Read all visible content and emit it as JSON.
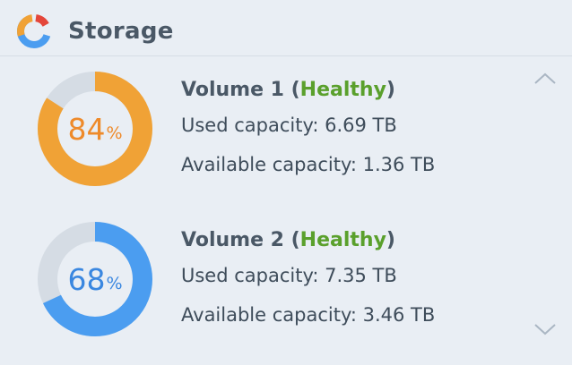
{
  "widget": {
    "title": "Storage",
    "icon": "storage-pie-icon",
    "colors": {
      "orange": "#f0a236",
      "orange_dark": "#e8862a",
      "blue": "#4b9df0",
      "blue_dark": "#3a87e0",
      "track": "#d5dce4",
      "healthy": "#5aa02c"
    }
  },
  "volumes": [
    {
      "name": "Volume 1",
      "status": "Healthy",
      "percent": 84,
      "percent_number": "84",
      "percent_symbol": "%",
      "used_line": "Used capacity: 6.69 TB",
      "available_line": "Available capacity: 1.36 TB"
    },
    {
      "name": "Volume 2",
      "status": "Healthy",
      "percent": 68,
      "percent_number": "68",
      "percent_symbol": "%",
      "used_line": "Used capacity: 7.35 TB",
      "available_line": "Available capacity: 3.46 TB"
    }
  ],
  "navigation": {
    "up_icon": "chevron-up-icon",
    "down_icon": "chevron-down-icon"
  }
}
